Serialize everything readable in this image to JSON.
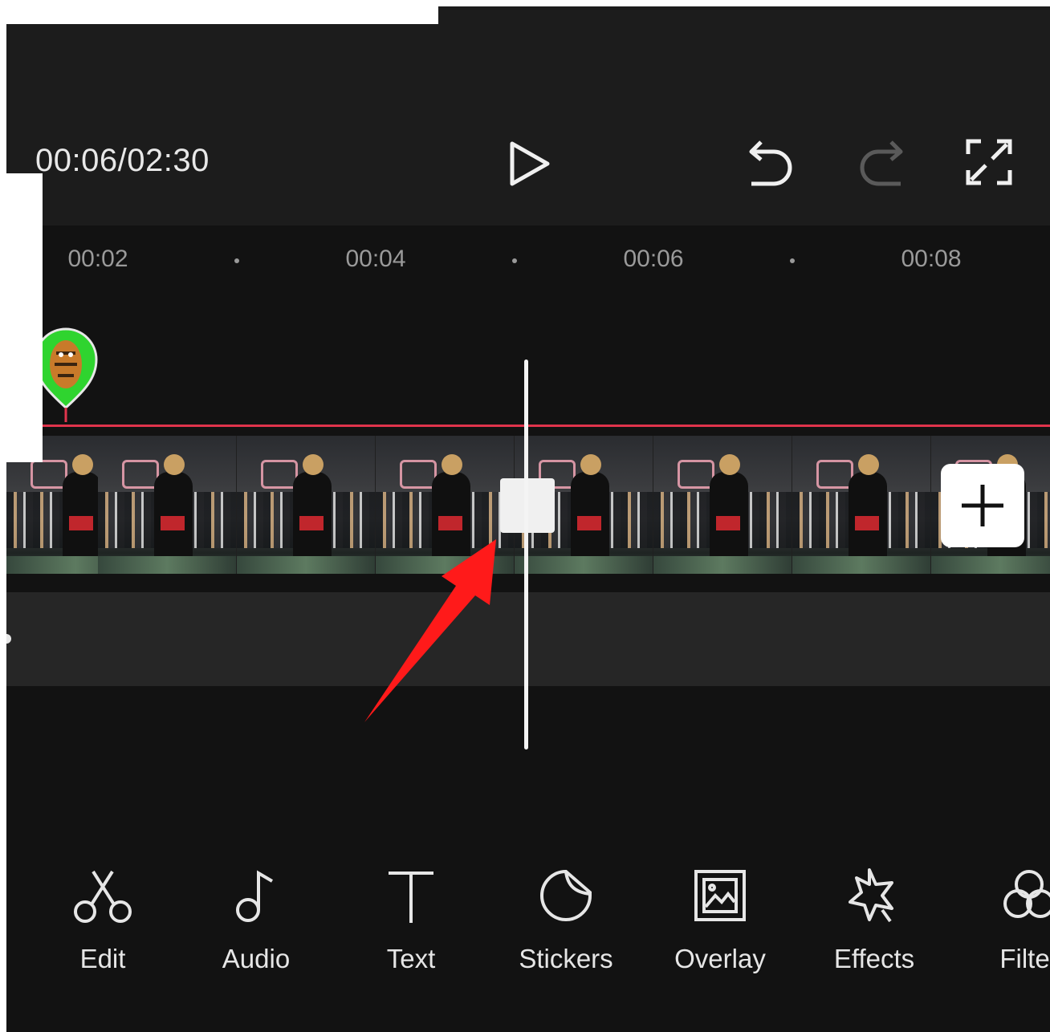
{
  "header": {
    "timecode": "00:06/02:30"
  },
  "ruler": {
    "labels": [
      "00:02",
      "00:04",
      "00:06",
      "00:08"
    ]
  },
  "toolbar": {
    "items": [
      {
        "label": "Edit",
        "icon": "scissors-icon"
      },
      {
        "label": "Audio",
        "icon": "music-note-icon"
      },
      {
        "label": "Text",
        "icon": "text-t-icon"
      },
      {
        "label": "Stickers",
        "icon": "sticker-icon"
      },
      {
        "label": "Overlay",
        "icon": "overlay-image-icon"
      },
      {
        "label": "Effects",
        "icon": "star-effects-icon"
      },
      {
        "label": "Filter",
        "icon": "filter-circles-icon"
      }
    ]
  },
  "colors": {
    "background": "#121212",
    "topbar": "#1c1c1c",
    "track_line": "#e0344c",
    "arrow": "#ff1a1a",
    "sticker": "#2fd42f"
  }
}
